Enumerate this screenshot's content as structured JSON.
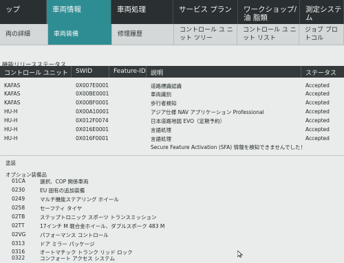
{
  "top_tabs": [
    {
      "label": "ップ",
      "active": false
    },
    {
      "label": "車両情報",
      "active": true
    },
    {
      "label": "車両処理",
      "active": false
    },
    {
      "label": "サービス プラン",
      "active": false
    },
    {
      "label": "ワークショップ/ 油 脂類",
      "active": false
    },
    {
      "label": "測定システム",
      "active": false
    }
  ],
  "sub_tabs": [
    {
      "label": "両の詳細",
      "active": false
    },
    {
      "label": "車両装備",
      "active": true
    },
    {
      "label": "修理履歴",
      "active": false
    },
    {
      "label": "コントロール ユ ニット ツリー",
      "active": false
    },
    {
      "label": "コントロール ユ ニット リスト",
      "active": false
    },
    {
      "label": "ジョブ プロトコル",
      "active": false
    }
  ],
  "release_section": {
    "title": "機能リリースステータス",
    "columns": [
      "コントロール ユニット",
      "SWID",
      "Feature-ID",
      "説明",
      "ステータス"
    ],
    "rows": [
      [
        "KAFAS",
        "0X007E0001",
        "",
        "道路標識認識",
        "Accepted"
      ],
      [
        "KAFAS",
        "0X00BE0001",
        "",
        "車両識別",
        "Accepted"
      ],
      [
        "KAFAS",
        "0X00BF0001",
        "",
        "歩行者検知",
        "Accepted"
      ],
      [
        "HU-H",
        "0X00A10001",
        "",
        "アジア仕様 NAV アプリケーション Professional",
        "Accepted"
      ],
      [
        "HU-H",
        "0X012F0074",
        "",
        "日本道路地図 EVO（定期予約）",
        "Accepted"
      ],
      [
        "HU-H",
        "0X016E0001",
        "",
        "言語処理",
        "Accepted"
      ],
      [
        "HU-H",
        "0X016F0001",
        "",
        "言語処理",
        "Accepted"
      ]
    ],
    "notice": "Secure Feature Activation (SFA) 情報を検知できませんでした！"
  },
  "label_sec": "塗装",
  "options_title": "オプション装備品",
  "options": [
    {
      "code": "01CA",
      "label": "選択、COP 関係車両"
    },
    {
      "code": "0230",
      "label": "EU 固有の追加装備"
    },
    {
      "code": "0249",
      "label": "マルチ機能ステアリング ホイール"
    },
    {
      "code": "0258",
      "label": "セーフティ タイヤ"
    },
    {
      "code": "02TB",
      "label": "ステップトロニック スポーツ トランスミッション"
    },
    {
      "code": "02TT",
      "label": "17インチ M 軽合金ホイール、ダブルスポーク 483 M"
    },
    {
      "code": "02VG",
      "label": "パフォーマンス コントロール"
    },
    {
      "code": "0313",
      "label": "ドア ミラー パッケージ"
    },
    {
      "code": "0316",
      "label": "オートマチック トランク リッド ロック"
    },
    {
      "code": "0322",
      "label": "コンフォート アクセス システム"
    }
  ]
}
